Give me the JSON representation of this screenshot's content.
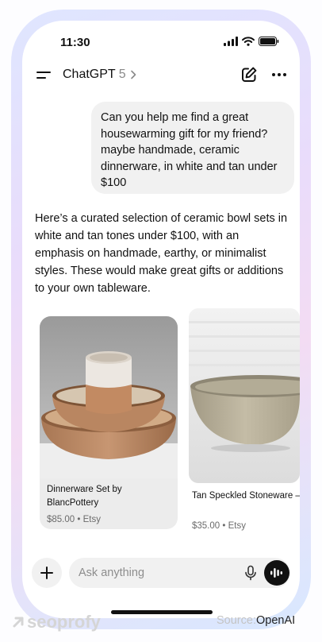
{
  "status_bar": {
    "time": "11:30"
  },
  "header": {
    "title": "ChatGPT",
    "version": "5"
  },
  "conversation": {
    "user_message": "Can you help me find a great housewarming gift for my friend? maybe handmade, ceramic dinnerware, in white and tan under $100",
    "assistant_message": "Here’s a curated selection of ceramic bowl sets in white and tan tones under $100, with an emphasis on handmade, earthy, or minimalist styles. These would make great gifts or additions to your own tableware."
  },
  "products": [
    {
      "name": "Dinnerware Set by BlancPottery",
      "price": "$85.00",
      "store": "Etsy"
    },
    {
      "name": "Tan Speckled Stoneware – Handmade",
      "price": "$35.00",
      "store": "Etsy"
    }
  ],
  "composer": {
    "placeholder": "Ask anything"
  },
  "watermark": {
    "brand": "seoprofy"
  },
  "source": {
    "label": "Source:",
    "value": "OpenAI"
  },
  "icons": {
    "menu": "menu-icon",
    "chevron": "chevron-right-icon",
    "edit": "new-chat-icon",
    "more": "more-icon",
    "plus": "plus-icon",
    "mic": "microphone-icon",
    "voice": "voice-mode-icon"
  }
}
